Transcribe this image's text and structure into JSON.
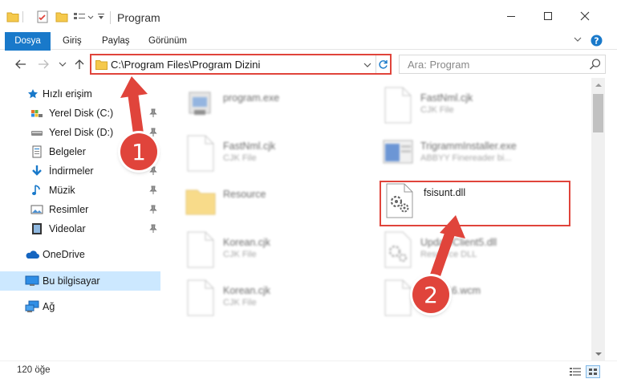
{
  "window": {
    "title": "Program",
    "minimize_glyph": "—",
    "maximize_glyph": "☐",
    "close_glyph": "✕"
  },
  "ribbon": {
    "tabs": [
      "Dosya",
      "Giriş",
      "Paylaş",
      "Görünüm"
    ],
    "expand_glyph": "⌄",
    "help_glyph": "?"
  },
  "nav": {
    "back_glyph": "←",
    "forward_glyph": "→",
    "recent_glyph": "⌄",
    "up_glyph": "↑",
    "address": "C:\\Program Files\\Program Dizini",
    "address_dropdown_glyph": "⌄",
    "search_placeholder": "Ara: Program"
  },
  "sidebar": {
    "items": [
      {
        "label": "Hızlı erişim",
        "icon": "star-icon"
      },
      {
        "label": "Yerel Disk (C:)",
        "icon": "drive-c-icon"
      },
      {
        "label": "Yerel Disk (D:)",
        "icon": "drive-icon"
      },
      {
        "label": "Belgeler",
        "icon": "documents-icon"
      },
      {
        "label": "İndirmeler",
        "icon": "download-icon"
      },
      {
        "label": "Müzik",
        "icon": "music-icon"
      },
      {
        "label": "Resimler",
        "icon": "pictures-icon"
      },
      {
        "label": "Videolar",
        "icon": "videos-icon"
      },
      {
        "label": "OneDrive",
        "icon": "onedrive-icon"
      },
      {
        "label": "Bu bilgisayar",
        "icon": "this-pc-icon"
      },
      {
        "label": "Ağ",
        "icon": "network-icon"
      }
    ]
  },
  "files": [
    {
      "name": "program.exe",
      "type": ""
    },
    {
      "name": "FastNml.cjk",
      "type": "CJK File"
    },
    {
      "name": "FastNml.cjk",
      "type": "CJK File"
    },
    {
      "name": "TrigrammInstaller.exe",
      "type": "ABBYY Finereader bi..."
    },
    {
      "name": "Resource",
      "type": ""
    },
    {
      "name": "fsisunt.dll",
      "type": ""
    },
    {
      "name": "Korean.cjk",
      "type": "CJK File"
    },
    {
      "name": "UpdateClient5.dll",
      "type": "Resource DLL"
    },
    {
      "name": "Korean.cjk",
      "type": "CJK File"
    },
    {
      "name": "StWP16.wcm",
      "type": "File"
    }
  ],
  "status": {
    "count": "120 öğe"
  },
  "annotations": {
    "badge1": "1",
    "badge2": "2",
    "accent": "#e0443b"
  },
  "colors": {
    "file_tab": "#1979ca",
    "selected_nav": "#cce8ff",
    "folder": "#f5c94c"
  }
}
